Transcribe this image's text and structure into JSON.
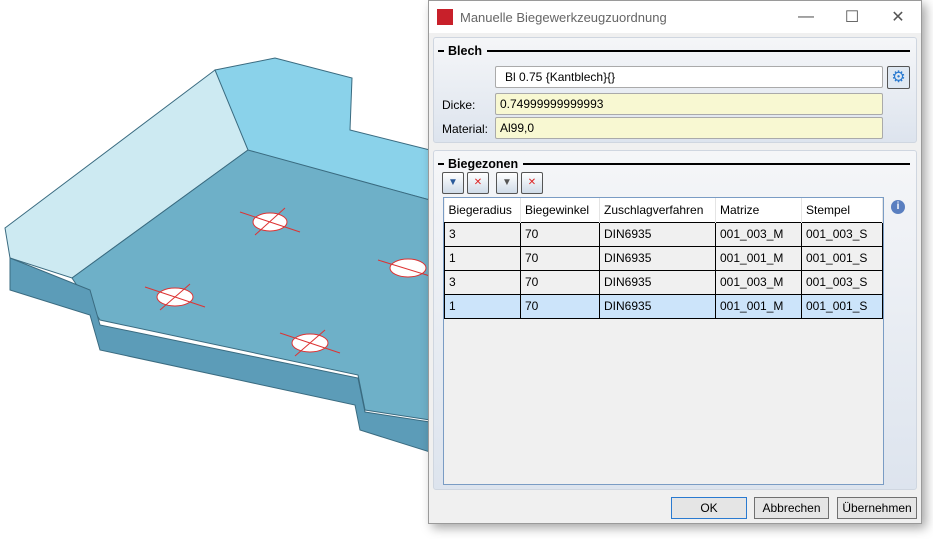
{
  "dialog": {
    "title": "Manuelle Biegewerkzeugzuordnung",
    "minimize": "—",
    "maximize": "☐",
    "close": "✕"
  },
  "blech": {
    "heading": "Blech",
    "name_value": "Bl 0.75 {Kantblech}{}",
    "dicke_label": "Dicke:",
    "dicke_value": "0.74999999999993",
    "material_label": "Material:",
    "material_value": "Al99,0"
  },
  "biegezonen": {
    "heading": "Biegezonen",
    "columns": [
      "Biegeradius",
      "Biegewinkel",
      "Zuschlagverfahren",
      "Matrize",
      "Stempel"
    ],
    "rows": [
      [
        "3",
        "70",
        "DIN6935",
        "001_003_M",
        "001_003_S"
      ],
      [
        "1",
        "70",
        "DIN6935",
        "001_001_M",
        "001_001_S"
      ],
      [
        "3",
        "70",
        "DIN6935",
        "001_003_M",
        "001_003_S"
      ],
      [
        "1",
        "70",
        "DIN6935",
        "001_001_M",
        "001_001_S"
      ]
    ],
    "selected_row": 3
  },
  "buttons": {
    "ok": "OK",
    "cancel": "Abbrechen",
    "apply": "Übernehmen"
  }
}
